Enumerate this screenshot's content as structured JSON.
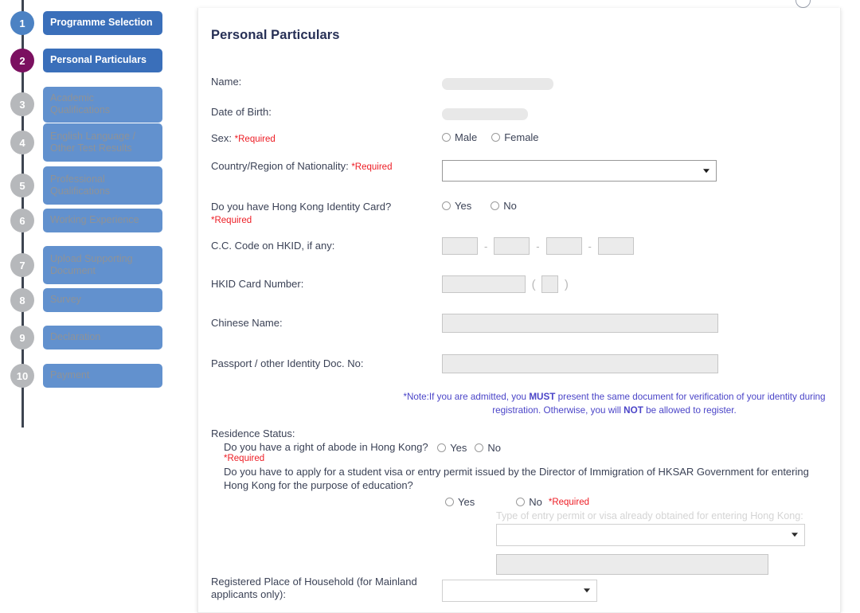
{
  "stepper": {
    "steps": [
      {
        "number": "1",
        "label": "Programme Selection",
        "state": "done"
      },
      {
        "number": "2",
        "label": "Personal Particulars",
        "state": "active"
      },
      {
        "number": "3",
        "label": "Academic Qualifications",
        "state": "todo"
      },
      {
        "number": "4",
        "label": "English Language / Other Test Results",
        "state": "todo"
      },
      {
        "number": "5",
        "label": "Professional Qualifications",
        "state": "todo"
      },
      {
        "number": "6",
        "label": "Working Experience",
        "state": "todo"
      },
      {
        "number": "7",
        "label": "Upload Supporting Document",
        "state": "todo"
      },
      {
        "number": "8",
        "label": "Survey",
        "state": "todo"
      },
      {
        "number": "9",
        "label": "Declaration",
        "state": "todo"
      },
      {
        "number": "10",
        "label": "Payment",
        "state": "todo"
      }
    ]
  },
  "page": {
    "title": "Personal Particulars"
  },
  "form": {
    "name_label": "Name:",
    "dob_label": "Date of Birth:",
    "sex_label": "Sex:",
    "sex_required": "*Required",
    "sex_options": [
      "Male",
      "Female"
    ],
    "nationality_label": "Country/Region of Nationality:",
    "nationality_required": "*Required",
    "nationality_value": "",
    "hkid_question_label": "Do you have Hong Kong Identity Card?",
    "hkid_question_required": "*Required",
    "hkid_options": [
      "Yes",
      "No"
    ],
    "cc_code_label": "C.C. Code on HKID, if any:",
    "cc_code_values": [
      "",
      "",
      "",
      ""
    ],
    "cc_separator": "-",
    "hkid_number_label": "HKID Card Number:",
    "hkid_number_value": "",
    "hkid_checkdigit_value": "",
    "chinese_name_label": "Chinese Name:",
    "chinese_name_value": "",
    "passport_label": "Passport / other Identity Doc. No:",
    "passport_value": "",
    "household_label": "Registered Place of Household (for Mainland applicants only):",
    "household_value": ""
  },
  "note": {
    "prefix": "*Note:If you are admitted, you ",
    "bold1": "MUST",
    "middle": " present the same document for verification of your identity during registration. Otherwise, you will ",
    "bold2": "NOT",
    "suffix": " be allowed to register."
  },
  "residence": {
    "heading": "Residence Status:",
    "abode_question": "Do you have a right of abode in Hong Kong?",
    "abode_options": [
      "Yes",
      "No"
    ],
    "abode_required": "*Required",
    "visa_question": "Do you have to apply for a student visa or entry permit issued by the Director of Immigration of HKSAR Government for entering Hong Kong for the purpose of education?",
    "visa_options": [
      "Yes",
      "No"
    ],
    "visa_required": "*Required",
    "entry_permit_label": "Type of entry permit or visa already obtained for entering Hong Kong:",
    "entry_permit_value": "",
    "entry_permit_other_value": ""
  },
  "colors": {
    "step_done": "#4c82c3",
    "step_active": "#7b1060",
    "step_todo": "#b6b8bb",
    "pill_on": "#3a6fba",
    "pill_off": "#6291ce",
    "required_red": "#ed1c24",
    "note_blue": "#4b45c8",
    "title_navy": "#262f55"
  }
}
